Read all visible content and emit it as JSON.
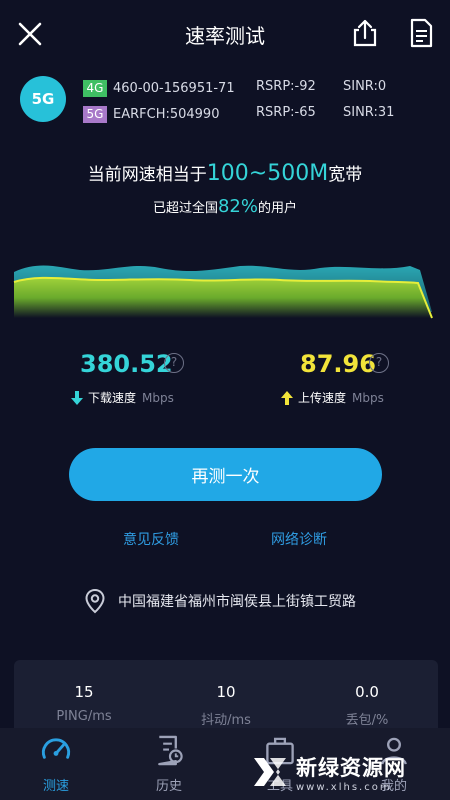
{
  "header": {
    "title": "速率测试",
    "close_icon": "close-icon",
    "share_icon": "share-icon",
    "document_icon": "document-icon"
  },
  "network": {
    "badge": "5G",
    "row_4g": {
      "tag": "4G",
      "id": "460-00-156951-71",
      "rsrp": "RSRP:-92",
      "sinr": "SINR:0"
    },
    "row_5g": {
      "tag": "5G",
      "id": "EARFCH:504990",
      "rsrp": "RSRP:-65",
      "sinr": "SINR:31"
    }
  },
  "summary": {
    "line1_prefix": "当前网速相当于",
    "line1_highlight": "100~500M",
    "line1_suffix": "宽带",
    "line2_prefix": "已超过全国",
    "line2_highlight": "82%",
    "line2_suffix": "的用户"
  },
  "download": {
    "value": "380.52",
    "label": "下载速度",
    "unit": "Mbps",
    "help": "?"
  },
  "upload": {
    "value": "87.96",
    "label": "上传速度",
    "unit": "Mbps",
    "help": "?"
  },
  "actions": {
    "retest_label": "再测一次",
    "feedback_label": "意见反馈",
    "diagnose_label": "网络诊断"
  },
  "location": {
    "text": "中国福建省福州市闽侯县上街镇工贸路",
    "icon": "location-pin-icon"
  },
  "stats": [
    {
      "value": "15",
      "label": "PING/ms"
    },
    {
      "value": "10",
      "label": "抖动/ms"
    },
    {
      "value": "0.0",
      "label": "丢包/%"
    }
  ],
  "nav": [
    {
      "label": "测速",
      "icon": "speedometer-icon",
      "active": true
    },
    {
      "label": "历史",
      "icon": "history-icon",
      "active": false
    },
    {
      "label": "工具",
      "icon": "toolbox-icon",
      "active": false
    },
    {
      "label": "我的",
      "icon": "user-icon",
      "active": false
    }
  ],
  "watermark": {
    "title": "新绿资源网",
    "url": "www.xlhs.com"
  },
  "colors": {
    "background": "#0e1124",
    "accent_cyan": "#35d4d8",
    "accent_yellow": "#f2e43a",
    "button_blue": "#21a8e6",
    "link_blue": "#2f9be0",
    "tag_4g": "#3fbf63",
    "tag_5g": "#a879c9"
  }
}
